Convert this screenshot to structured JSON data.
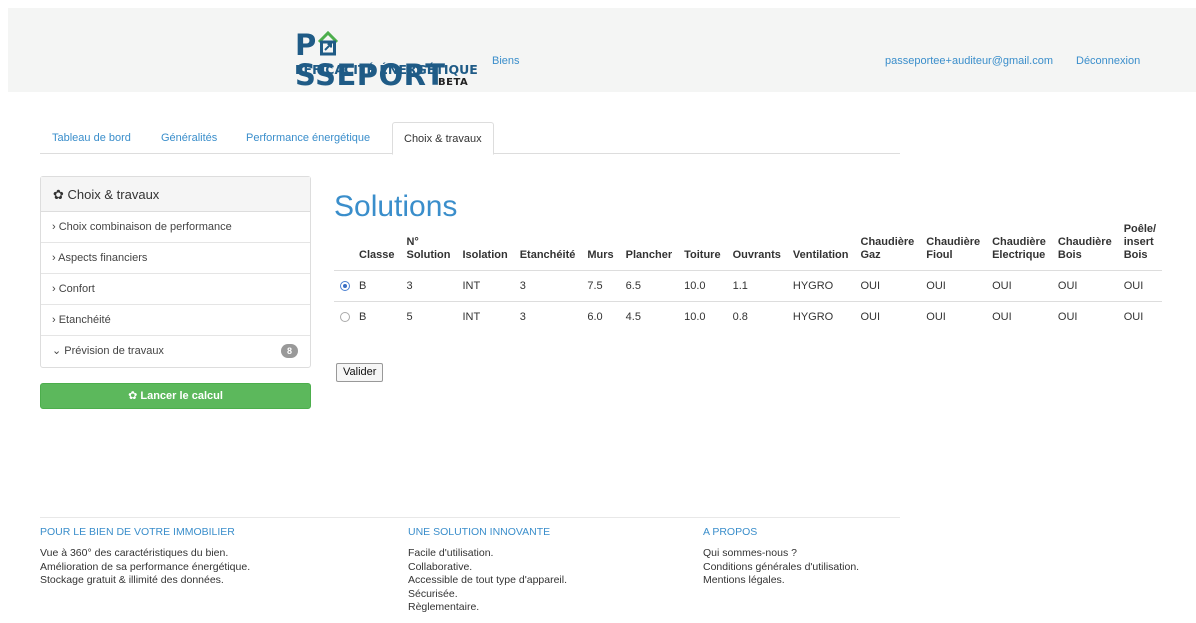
{
  "header": {
    "logo_main": "PASSEPORT",
    "logo_sub": "EFFICACITÉ ÉNERGÉTIQUE",
    "logo_beta": "BETA",
    "nav_biens": "Biens",
    "user_email": "passeportee+auditeur@gmail.com",
    "logout": "Déconnexion"
  },
  "tabs": [
    {
      "label": "Tableau de bord"
    },
    {
      "label": "Généralités"
    },
    {
      "label": "Performance énergétique"
    },
    {
      "label": "Choix & travaux"
    }
  ],
  "sidebar": {
    "title": "Choix & travaux",
    "items": [
      {
        "label": "› Choix combinaison de performance"
      },
      {
        "label": "› Aspects financiers"
      },
      {
        "label": "› Confort"
      },
      {
        "label": "› Etanchéité"
      },
      {
        "label": "⌄ Prévision de travaux",
        "badge": "8"
      }
    ],
    "run_button": "✿ Lancer le calcul"
  },
  "main": {
    "title": "Solutions",
    "table": {
      "headers": [
        {
          "l1": "",
          "l2": "",
          "l3": ""
        },
        {
          "l1": "",
          "l2": "",
          "l3": "Classe"
        },
        {
          "l1": "",
          "l2": "N°",
          "l3": "Solution"
        },
        {
          "l1": "",
          "l2": "",
          "l3": "Isolation"
        },
        {
          "l1": "",
          "l2": "",
          "l3": "Etanchéité"
        },
        {
          "l1": "",
          "l2": "",
          "l3": "Murs"
        },
        {
          "l1": "",
          "l2": "",
          "l3": "Plancher"
        },
        {
          "l1": "",
          "l2": "",
          "l3": "Toiture"
        },
        {
          "l1": "",
          "l2": "",
          "l3": "Ouvrants"
        },
        {
          "l1": "",
          "l2": "",
          "l3": "Ventilation"
        },
        {
          "l1": "",
          "l2": "Chaudière",
          "l3": "Gaz"
        },
        {
          "l1": "",
          "l2": "Chaudière",
          "l3": "Fioul"
        },
        {
          "l1": "",
          "l2": "Chaudière",
          "l3": "Electrique"
        },
        {
          "l1": "",
          "l2": "Chaudière",
          "l3": "Bois"
        },
        {
          "l1": "Poêle/",
          "l2": "insert",
          "l3": "Bois"
        }
      ],
      "rows": [
        {
          "selected": true,
          "cells": [
            "B",
            "3",
            "INT",
            "3",
            "7.5",
            "6.5",
            "10.0",
            "1.1",
            "HYGRO",
            "OUI",
            "OUI",
            "OUI",
            "OUI",
            "OUI"
          ]
        },
        {
          "selected": false,
          "cells": [
            "B",
            "5",
            "INT",
            "3",
            "6.0",
            "4.5",
            "10.0",
            "0.8",
            "HYGRO",
            "OUI",
            "OUI",
            "OUI",
            "OUI",
            "OUI"
          ]
        }
      ]
    },
    "validate_button": "Valider"
  },
  "footer": {
    "col1": {
      "title": "POUR LE BIEN DE VOTRE IMMOBILIER",
      "lines": [
        "Vue à 360° des caractéristiques du bien.",
        "Amélioration de sa performance énergétique.",
        "Stockage gratuit & illimité des données."
      ]
    },
    "col2": {
      "title": "UNE SOLUTION INNOVANTE",
      "lines": [
        "Facile d'utilisation.",
        "Collaborative.",
        "Accessible de tout type d'appareil.",
        "Sécurisée.",
        "Règlementaire."
      ]
    },
    "col3": {
      "title": "A PROPOS",
      "lines": [
        "Qui sommes-nous ?",
        "Conditions générales d'utilisation.",
        "Mentions légales."
      ]
    }
  },
  "colors": {
    "brand": "#1f5b86",
    "link": "#3a8ecb",
    "success": "#5cb85c"
  }
}
